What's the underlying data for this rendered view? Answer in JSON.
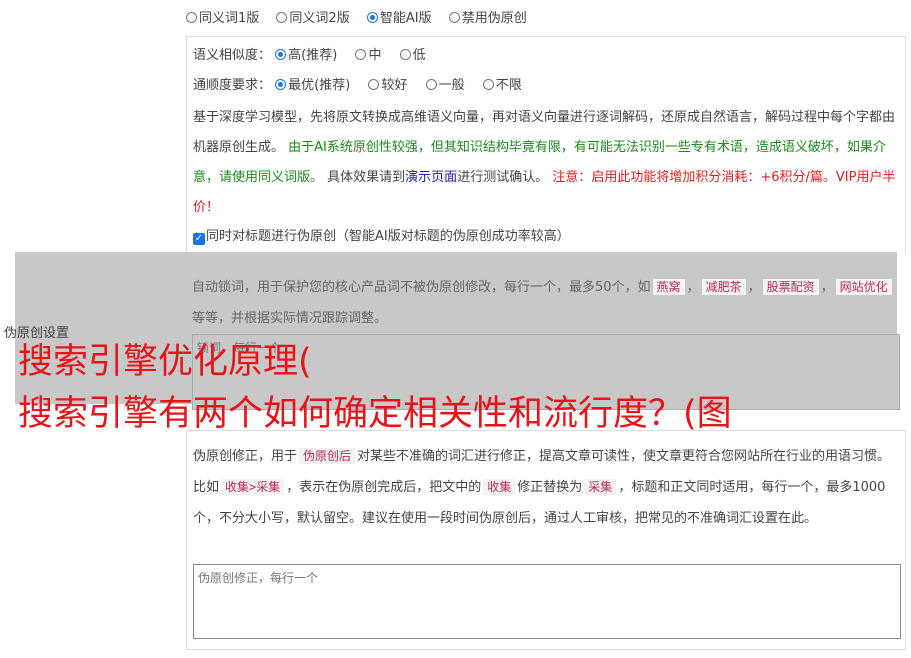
{
  "version_options": [
    {
      "label": "同义词1版",
      "selected": false
    },
    {
      "label": "同义词2版",
      "selected": false
    },
    {
      "label": "智能AI版",
      "selected": true
    },
    {
      "label": "禁用伪原创",
      "selected": false
    }
  ],
  "similarity": {
    "label": "语义相似度：",
    "options": [
      {
        "label": "高(推荐)",
        "selected": true
      },
      {
        "label": "中",
        "selected": false
      },
      {
        "label": "低",
        "selected": false
      }
    ]
  },
  "fluency": {
    "label": "通顺度要求：",
    "options": [
      {
        "label": "最优(推荐)",
        "selected": true
      },
      {
        "label": "较好",
        "selected": false
      },
      {
        "label": "一般",
        "selected": false
      },
      {
        "label": "不限",
        "selected": false
      }
    ]
  },
  "description": {
    "part1": "基于深度学习模型，先将原文转换成高维语义向量，再对语义向量进行逐词解码，还原成自然语言，解码过程中每个字都由机器原创生成。",
    "part2_green": "由于AI系统原创性较强，但其知识结构毕竟有限，有可能无法识别一些专有术语，造成语义破坏，如果介意，请使用同义词版。",
    "part3": "具体效果请到",
    "demo_link": "演示页面",
    "part4": "进行测试确认。",
    "part5_red": "注意：启用此功能将增加积分消耗：+6积分/篇。VIP用户半价！"
  },
  "title_checkbox": {
    "label": "同时对标题进行伪原创（智能AI版对标题的伪原创成功率较高）",
    "checked": true
  },
  "lock_words": {
    "desc_before": "自动锁词，用于保护您的核心产品词不被伪原创修改，每行一个，最多50个，如",
    "examples": [
      "燕窝",
      "减肥茶",
      "股票配资",
      "网站优化"
    ],
    "desc_after": "等等，并根据实际情况跟踪调整。",
    "placeholder": "锁词，每行一个"
  },
  "settings_label": "伪原创设置",
  "overlay_title": {
    "line1": "搜索引擎优化原理(",
    "line2": "搜索引擎有两个如何确定相关性和流行度？(图"
  },
  "corrections": {
    "desc1": "伪原创修正，用于",
    "tag1": "伪原创后",
    "desc2": "对某些不准确的词汇进行修正，提高文章可读性，使文章更符合您网站所在行业的用语习惯。比如",
    "tag2": "收集>采集",
    "desc3": "，表示在伪原创完成后，把文中的",
    "tag3": "收集",
    "desc4": "修正替换为",
    "tag4": "采集",
    "desc5": "，标题和正文同时适用，每行一个，最多1000个，不分大小写，默认留空。建议在使用一段时间伪原创后，通过人工审核，把常见的不准确词汇设置在此。",
    "placeholder": "伪原创修正，每行一个"
  }
}
